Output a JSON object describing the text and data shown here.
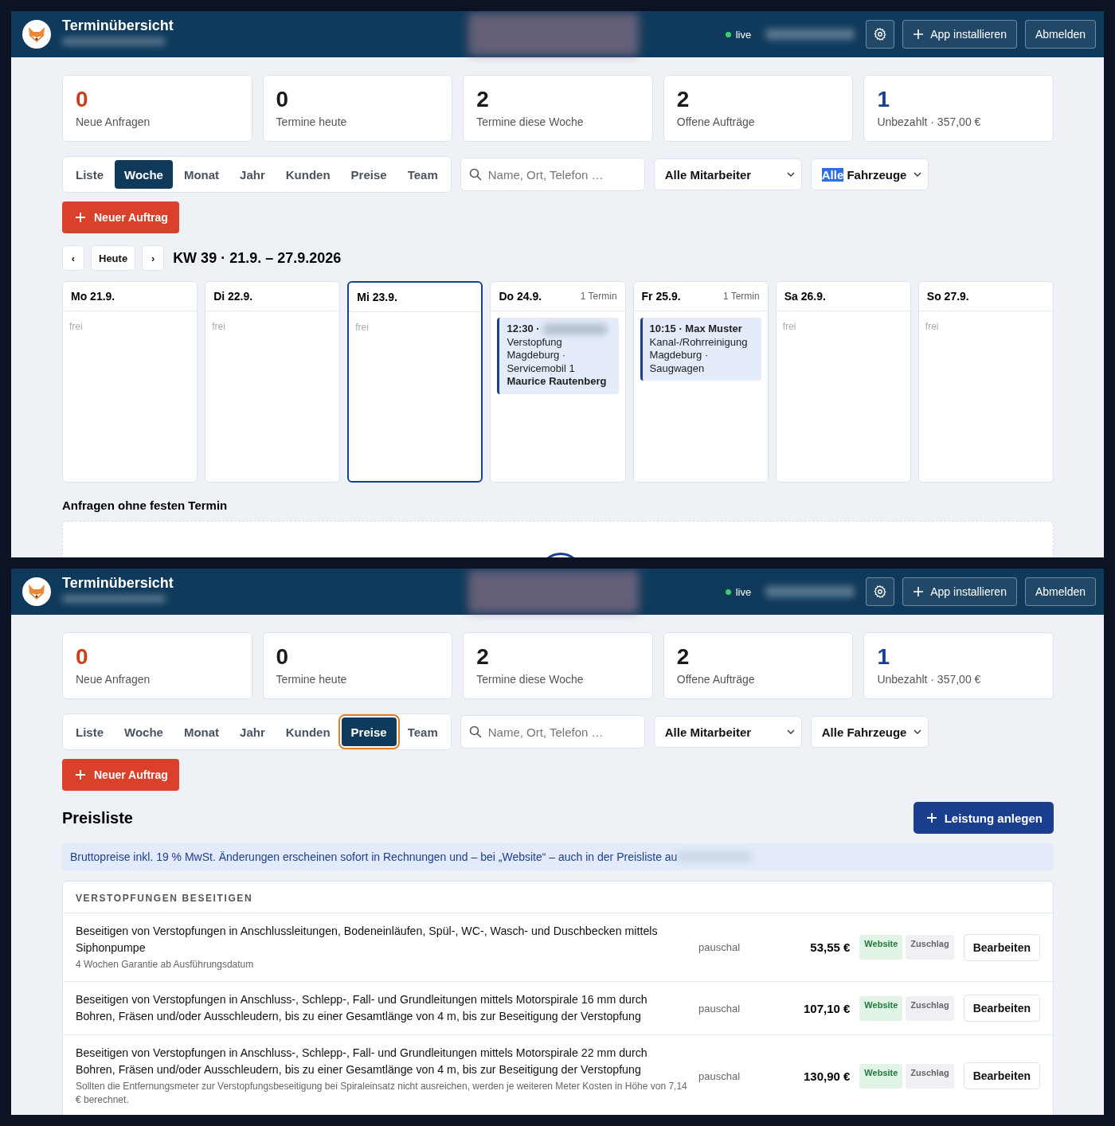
{
  "panels": [
    {
      "header": {
        "title": "Terminübersicht",
        "status": "live",
        "install_button": "App installieren",
        "logout_button": "Abmelden"
      },
      "stats": [
        {
          "value": "0",
          "label": "Neue Anfragen",
          "color": "#c8401f"
        },
        {
          "value": "0",
          "label": "Termine heute",
          "color": "#1a1a1a"
        },
        {
          "value": "2",
          "label": "Termine diese Woche",
          "color": "#1a1a1a"
        },
        {
          "value": "2",
          "label": "Offene Aufträge",
          "color": "#1a1a1a"
        },
        {
          "value": "1",
          "label": "Unbezahlt · 357,00 €",
          "color": "#1b3e8f"
        }
      ],
      "tabs": [
        {
          "label": "Liste",
          "selected": false,
          "focused": false
        },
        {
          "label": "Woche",
          "selected": true,
          "focused": false
        },
        {
          "label": "Monat",
          "selected": false,
          "focused": false
        },
        {
          "label": "Jahr",
          "selected": false,
          "focused": false
        },
        {
          "label": "Kunden",
          "selected": false,
          "focused": false
        },
        {
          "label": "Preise",
          "selected": false,
          "focused": false
        },
        {
          "label": "Team",
          "selected": false,
          "focused": false
        }
      ],
      "search": {
        "placeholder": "Name, Ort, Telefon …"
      },
      "filters": [
        {
          "parts": [
            {
              "text": "Alle Mitarbeiter",
              "highlighted": false
            }
          ]
        },
        {
          "parts": [
            {
              "text": "Alle",
              "highlighted": true
            },
            {
              "text": " Fahrzeuge",
              "highlighted": false
            }
          ]
        }
      ],
      "new_button": "Neuer Auftrag",
      "view": {
        "kind": "week",
        "prev": "‹",
        "today": "Heute",
        "next": "›",
        "title": "KW 39 · 21.9. – 27.9.2026",
        "days": [
          {
            "label": "Mo 21.9.",
            "selected": false,
            "empty_text": "frei"
          },
          {
            "label": "Di 22.9.",
            "selected": false,
            "empty_text": "frei"
          },
          {
            "label": "Mi 23.9.",
            "selected": true,
            "empty_text": "frei"
          },
          {
            "label": "Do 24.9.",
            "selected": false,
            "count": "1 Termin",
            "events": [
              {
                "heading": "12:30 ·",
                "name_hidden": true,
                "lines": [
                  "Verstopfung",
                  "Magdeburg · Servicemobil 1"
                ],
                "assignee": "Maurice Rautenberg"
              }
            ]
          },
          {
            "label": "Fr 25.9.",
            "selected": false,
            "count": "1 Termin",
            "events": [
              {
                "heading": "10:15 · Max Muster",
                "name_hidden": false,
                "lines": [
                  "Kanal-/Rohrreinigung",
                  "Magdeburg · Saugwagen"
                ]
              }
            ]
          },
          {
            "label": "Sa 26.9.",
            "selected": false,
            "empty_text": "frei"
          },
          {
            "label": "So 27.9.",
            "selected": false,
            "empty_text": "frei"
          }
        ],
        "unscheduled": {
          "title": "Anfragen ohne festen Termin",
          "loading": true
        }
      }
    },
    {
      "header": {
        "title": "Terminübersicht",
        "status": "live",
        "install_button": "App installieren",
        "logout_button": "Abmelden"
      },
      "stats": [
        {
          "value": "0",
          "label": "Neue Anfragen",
          "color": "#c8401f"
        },
        {
          "value": "0",
          "label": "Termine heute",
          "color": "#1a1a1a"
        },
        {
          "value": "2",
          "label": "Termine diese Woche",
          "color": "#1a1a1a"
        },
        {
          "value": "2",
          "label": "Offene Aufträge",
          "color": "#1a1a1a"
        },
        {
          "value": "1",
          "label": "Unbezahlt · 357,00 €",
          "color": "#1b3e8f"
        }
      ],
      "tabs": [
        {
          "label": "Liste",
          "selected": false,
          "focused": false
        },
        {
          "label": "Woche",
          "selected": false,
          "focused": false
        },
        {
          "label": "Monat",
          "selected": false,
          "focused": false
        },
        {
          "label": "Jahr",
          "selected": false,
          "focused": false
        },
        {
          "label": "Kunden",
          "selected": false,
          "focused": false
        },
        {
          "label": "Preise",
          "selected": true,
          "focused": true
        },
        {
          "label": "Team",
          "selected": false,
          "focused": false
        }
      ],
      "search": {
        "placeholder": "Name, Ort, Telefon …"
      },
      "filters": [
        {
          "parts": [
            {
              "text": "Alle Mitarbeiter",
              "highlighted": false
            }
          ]
        },
        {
          "parts": [
            {
              "text": "Alle Fahrzeuge",
              "highlighted": false
            }
          ]
        }
      ],
      "new_button": "Neuer Auftrag",
      "view": {
        "kind": "prices",
        "title": "Preisliste",
        "add_button": "Leistung anlegen",
        "info": "Bruttopreise inkl. 19 % MwSt. Änderungen erscheinen sofort in Rechnungen und – bei „Website“ – auch in der Preisliste au",
        "categories": [
          {
            "title": "VERSTOPFUNGEN BESEITIGEN",
            "rows": [
              {
                "description": "Beseitigen von Verstopfungen in Anschlussleitungen, Bodeneinläufen, Spül-, WC-, Wasch- und Duschbecken mittels Siphonpumpe",
                "note": "4 Wochen Garantie ab Ausführungsdatum",
                "unit": "pauschal",
                "price": "53,55 €",
                "tags": [
                  {
                    "label": "Website",
                    "active": true
                  },
                  {
                    "label": "Zuschlag",
                    "active": false
                  }
                ],
                "action": "Bearbeiten"
              },
              {
                "description": "Beseitigen von Verstopfungen in Anschluss-, Schlepp-, Fall- und Grundleitungen mittels Motorspirale 16 mm durch Bohren, Fräsen und/oder Ausschleudern, bis zu einer Gesamtlänge von 4 m, bis zur Beseitigung der Verstopfung",
                "unit": "pauschal",
                "price": "107,10 €",
                "tags": [
                  {
                    "label": "Website",
                    "active": true
                  },
                  {
                    "label": "Zuschlag",
                    "active": false
                  }
                ],
                "action": "Bearbeiten"
              },
              {
                "description": "Beseitigen von Verstopfungen in Anschluss-, Schlepp-, Fall- und Grundleitungen mittels Motorspirale 22 mm durch Bohren, Fräsen und/oder Ausschleudern, bis zu einer Gesamtlänge von 4 m, bis zur Beseitigung der Verstopfung",
                "note": "Sollten die Entfernungsmeter zur Verstopfungsbeseitigung bei Spiraleinsatz nicht ausreichen, werden je weiteren Meter Kosten in Höhe von 7,14 € berechnet.",
                "unit": "pauschal",
                "price": "130,90 €",
                "tags": [
                  {
                    "label": "Website",
                    "active": true
                  },
                  {
                    "label": "Zuschlag",
                    "active": false
                  }
                ],
                "action": "Bearbeiten"
              }
            ]
          }
        ]
      }
    }
  ]
}
